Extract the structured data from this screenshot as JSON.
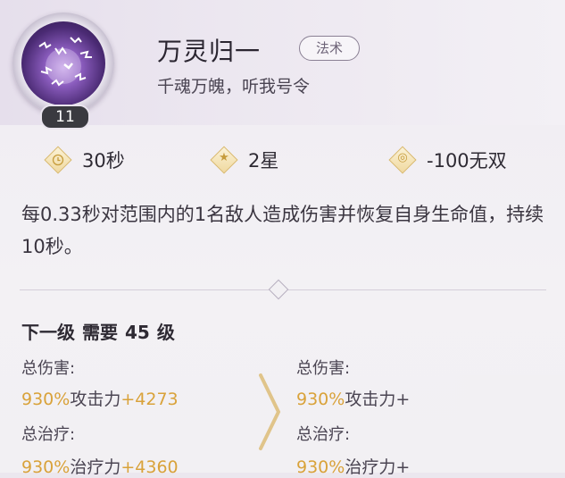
{
  "skill": {
    "name": "万灵归一",
    "tag": "法术",
    "motto": "千魂万魄，听我号令",
    "level": "11"
  },
  "stats": {
    "cooldown": "30秒",
    "stars": "2星",
    "cost": "-100无双"
  },
  "description": "每0.33秒对范围内的1名敌人造成伤害并恢复自身生命值，持续10秒。",
  "next_level": {
    "label": "下一级",
    "requirement": "需要",
    "level": "45",
    "unit": "级"
  },
  "current": {
    "damage_label": "总伤害:",
    "damage_pct": "930%",
    "damage_text": "攻击力",
    "damage_bonus": "+4273",
    "heal_label": "总治疗:",
    "heal_pct": "930%",
    "heal_text": "治疗力",
    "heal_bonus": "+4360"
  },
  "next": {
    "damage_label": "总伤害:",
    "damage_pct": "930%",
    "damage_text": "攻击力",
    "damage_bonus": "+",
    "heal_label": "总治疗:",
    "heal_pct": "930%",
    "heal_text": "治疗力",
    "heal_bonus": "+"
  },
  "colors": {
    "accent_gold": "#d9a23a",
    "icon_purple": "#8a5cbd"
  },
  "icons": {
    "cooldown": "clock-icon",
    "stars": "star-icon",
    "cost": "swirl-icon"
  }
}
